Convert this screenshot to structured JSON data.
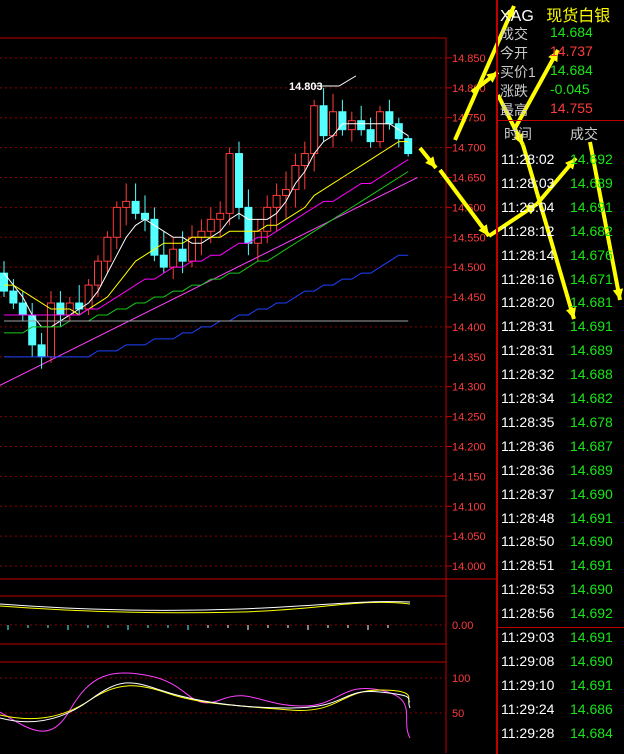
{
  "quote": {
    "symbol": "XAG",
    "name": "现货白银",
    "rows": [
      {
        "label": "成交",
        "value": "14.684",
        "color": "#19e619"
      },
      {
        "label": "今开",
        "value": "14.737",
        "color": "#ff3b3b"
      },
      {
        "label": "买价1",
        "value": "14.684",
        "color": "#19e619"
      },
      {
        "label": "涨跌",
        "value": "-0.045",
        "color": "#19e619"
      },
      {
        "label": "最高",
        "value": "14.755",
        "color": "#ff3b3b"
      }
    ]
  },
  "ticks": {
    "header_time": "时间",
    "header_price": "成交",
    "rows": [
      {
        "time": "11:28:02",
        "price": "14.692"
      },
      {
        "time": "11:28:03",
        "price": "14.689"
      },
      {
        "time": "11:28:04",
        "price": "14.691"
      },
      {
        "time": "11:28:12",
        "price": "14.682"
      },
      {
        "time": "11:28:14",
        "price": "14.676"
      },
      {
        "time": "11:28:16",
        "price": "14.671"
      },
      {
        "time": "11:28:20",
        "price": "14.681"
      },
      {
        "time": "11:28:31",
        "price": "14.691"
      },
      {
        "time": "11:28:31",
        "price": "14.689"
      },
      {
        "time": "11:28:32",
        "price": "14.688"
      },
      {
        "time": "11:28:34",
        "price": "14.682"
      },
      {
        "time": "11:28:35",
        "price": "14.678"
      },
      {
        "time": "11:28:36",
        "price": "14.687"
      },
      {
        "time": "11:28:36",
        "price": "14.689"
      },
      {
        "time": "11:28:37",
        "price": "14.690"
      },
      {
        "time": "11:28:48",
        "price": "14.691"
      },
      {
        "time": "11:28:50",
        "price": "14.690"
      },
      {
        "time": "11:28:51",
        "price": "14.691"
      },
      {
        "time": "11:28:53",
        "price": "14.690"
      },
      {
        "time": "11:28:56",
        "price": "14.692"
      },
      {
        "time": "11:29:03",
        "price": "14.691"
      },
      {
        "time": "11:29:08",
        "price": "14.690"
      },
      {
        "time": "11:29:10",
        "price": "14.691"
      },
      {
        "time": "11:29:24",
        "price": "14.686"
      },
      {
        "time": "11:29:28",
        "price": "14.684"
      }
    ]
  },
  "colors": {
    "up": "#ff3b3b",
    "down": "#54ffff",
    "grid": "#8b0000",
    "axis": "#ff3b3b",
    "tick_price": "#19e619"
  },
  "chart_data": {
    "type": "candlestick",
    "price_axis": {
      "ticks": [
        14.85,
        14.8,
        14.75,
        14.7,
        14.65,
        14.6,
        14.55,
        14.5,
        14.45,
        14.4,
        14.35,
        14.3,
        14.25,
        14.2,
        14.15,
        14.1,
        14.05,
        14.0
      ],
      "tick_labels": [
        "14.850",
        "14.800",
        "14.750",
        "14.700",
        "14.650",
        "14.600",
        "14.550",
        "14.500",
        "14.450",
        "14.400",
        "14.350",
        "14.300",
        "14.250",
        "14.200",
        "14.150",
        "14.100",
        "14.050",
        "14.000"
      ],
      "ylim": [
        13.98,
        14.88
      ]
    },
    "high_label": "14.803",
    "candles": [
      {
        "o": 14.49,
        "h": 14.51,
        "l": 14.45,
        "c": 14.46
      },
      {
        "o": 14.46,
        "h": 14.48,
        "l": 14.43,
        "c": 14.44
      },
      {
        "o": 14.44,
        "h": 14.46,
        "l": 14.41,
        "c": 14.42
      },
      {
        "o": 14.42,
        "h": 14.44,
        "l": 14.35,
        "c": 14.37
      },
      {
        "o": 14.37,
        "h": 14.39,
        "l": 14.33,
        "c": 14.35
      },
      {
        "o": 14.35,
        "h": 14.46,
        "l": 14.34,
        "c": 14.44
      },
      {
        "o": 14.44,
        "h": 14.46,
        "l": 14.4,
        "c": 14.42
      },
      {
        "o": 14.42,
        "h": 14.45,
        "l": 14.41,
        "c": 14.44
      },
      {
        "o": 14.44,
        "h": 14.47,
        "l": 14.42,
        "c": 14.43
      },
      {
        "o": 14.43,
        "h": 14.48,
        "l": 14.42,
        "c": 14.47
      },
      {
        "o": 14.47,
        "h": 14.52,
        "l": 14.45,
        "c": 14.51
      },
      {
        "o": 14.51,
        "h": 14.56,
        "l": 14.49,
        "c": 14.55
      },
      {
        "o": 14.55,
        "h": 14.61,
        "l": 14.53,
        "c": 14.6
      },
      {
        "o": 14.6,
        "h": 14.64,
        "l": 14.57,
        "c": 14.61
      },
      {
        "o": 14.61,
        "h": 14.64,
        "l": 14.58,
        "c": 14.59
      },
      {
        "o": 14.59,
        "h": 14.62,
        "l": 14.56,
        "c": 14.58
      },
      {
        "o": 14.58,
        "h": 14.6,
        "l": 14.51,
        "c": 14.52
      },
      {
        "o": 14.52,
        "h": 14.56,
        "l": 14.49,
        "c": 14.5
      },
      {
        "o": 14.5,
        "h": 14.55,
        "l": 14.48,
        "c": 14.53
      },
      {
        "o": 14.53,
        "h": 14.56,
        "l": 14.49,
        "c": 14.51
      },
      {
        "o": 14.51,
        "h": 14.57,
        "l": 14.5,
        "c": 14.55
      },
      {
        "o": 14.55,
        "h": 14.58,
        "l": 14.52,
        "c": 14.56
      },
      {
        "o": 14.56,
        "h": 14.6,
        "l": 14.54,
        "c": 14.58
      },
      {
        "o": 14.58,
        "h": 14.61,
        "l": 14.55,
        "c": 14.59
      },
      {
        "o": 14.59,
        "h": 14.7,
        "l": 14.57,
        "c": 14.69
      },
      {
        "o": 14.69,
        "h": 14.71,
        "l": 14.58,
        "c": 14.6
      },
      {
        "o": 14.6,
        "h": 14.63,
        "l": 14.52,
        "c": 14.54
      },
      {
        "o": 14.54,
        "h": 14.58,
        "l": 14.51,
        "c": 14.56
      },
      {
        "o": 14.56,
        "h": 14.62,
        "l": 14.54,
        "c": 14.6
      },
      {
        "o": 14.6,
        "h": 14.64,
        "l": 14.56,
        "c": 14.62
      },
      {
        "o": 14.62,
        "h": 14.66,
        "l": 14.58,
        "c": 14.63
      },
      {
        "o": 14.63,
        "h": 14.69,
        "l": 14.6,
        "c": 14.67
      },
      {
        "o": 14.67,
        "h": 14.71,
        "l": 14.63,
        "c": 14.69
      },
      {
        "o": 14.69,
        "h": 14.78,
        "l": 14.66,
        "c": 14.77
      },
      {
        "o": 14.77,
        "h": 14.8,
        "l": 14.71,
        "c": 14.72
      },
      {
        "o": 14.72,
        "h": 14.79,
        "l": 14.7,
        "c": 14.76
      },
      {
        "o": 14.76,
        "h": 14.78,
        "l": 14.72,
        "c": 14.73
      },
      {
        "o": 14.73,
        "h": 14.76,
        "l": 14.71,
        "c": 14.745
      },
      {
        "o": 14.745,
        "h": 14.77,
        "l": 14.72,
        "c": 14.73
      },
      {
        "o": 14.73,
        "h": 14.75,
        "l": 14.7,
        "c": 14.71
      },
      {
        "o": 14.71,
        "h": 14.77,
        "l": 14.7,
        "c": 14.76
      },
      {
        "o": 14.76,
        "h": 14.78,
        "l": 14.73,
        "c": 14.74
      },
      {
        "o": 14.74,
        "h": 14.75,
        "l": 14.7,
        "c": 14.715
      },
      {
        "o": 14.715,
        "h": 14.72,
        "l": 14.685,
        "c": 14.69
      }
    ],
    "ma_lines": [
      {
        "color": "#ffffff",
        "values": [
          14.49,
          14.47,
          14.45,
          14.42,
          14.4,
          14.4,
          14.41,
          14.42,
          14.43,
          14.44,
          14.46,
          14.49,
          14.52,
          14.55,
          14.57,
          14.58,
          14.57,
          14.56,
          14.55,
          14.55,
          14.54,
          14.54,
          14.55,
          14.56,
          14.58,
          14.59,
          14.58,
          14.58,
          14.58,
          14.59,
          14.61,
          14.64,
          14.66,
          14.69,
          14.71,
          14.72,
          14.74,
          14.74,
          14.74,
          14.74,
          14.74,
          14.74,
          14.73,
          14.72
        ]
      },
      {
        "color": "#ffff00",
        "values": [
          14.47,
          14.47,
          14.46,
          14.45,
          14.44,
          14.43,
          14.43,
          14.43,
          14.42,
          14.43,
          14.44,
          14.45,
          14.47,
          14.49,
          14.51,
          14.52,
          14.53,
          14.54,
          14.54,
          14.54,
          14.55,
          14.55,
          14.55,
          14.55,
          14.56,
          14.56,
          14.56,
          14.56,
          14.57,
          14.57,
          14.58,
          14.59,
          14.6,
          14.62,
          14.63,
          14.64,
          14.65,
          14.66,
          14.67,
          14.68,
          14.69,
          14.7,
          14.71,
          14.71
        ]
      },
      {
        "color": "#ff00ff",
        "values": [
          14.42,
          14.42,
          14.42,
          14.42,
          14.42,
          14.42,
          14.42,
          14.42,
          14.42,
          14.43,
          14.43,
          14.44,
          14.45,
          14.46,
          14.47,
          14.48,
          14.48,
          14.49,
          14.5,
          14.5,
          14.51,
          14.51,
          14.52,
          14.52,
          14.53,
          14.54,
          14.54,
          14.55,
          14.55,
          14.56,
          14.57,
          14.58,
          14.59,
          14.6,
          14.61,
          14.61,
          14.62,
          14.63,
          14.64,
          14.64,
          14.65,
          14.66,
          14.67,
          14.68
        ]
      },
      {
        "color": "#19c819",
        "values": [
          14.39,
          14.39,
          14.39,
          14.4,
          14.4,
          14.4,
          14.4,
          14.41,
          14.41,
          14.41,
          14.42,
          14.42,
          14.43,
          14.43,
          14.44,
          14.44,
          14.45,
          14.45,
          14.46,
          14.46,
          14.47,
          14.47,
          14.48,
          14.48,
          14.49,
          14.49,
          14.5,
          14.51,
          14.51,
          14.52,
          14.53,
          14.54,
          14.55,
          14.56,
          14.57,
          14.58,
          14.59,
          14.6,
          14.61,
          14.62,
          14.63,
          14.64,
          14.65,
          14.66
        ]
      },
      {
        "color": "#2040ff",
        "values": [
          14.35,
          14.35,
          14.35,
          14.35,
          14.35,
          14.35,
          14.35,
          14.35,
          14.35,
          14.35,
          14.36,
          14.36,
          14.36,
          14.37,
          14.37,
          14.37,
          14.38,
          14.38,
          14.38,
          14.39,
          14.39,
          14.4,
          14.4,
          14.41,
          14.41,
          14.42,
          14.42,
          14.43,
          14.43,
          14.44,
          14.44,
          14.45,
          14.46,
          14.46,
          14.47,
          14.47,
          14.48,
          14.48,
          14.49,
          14.49,
          14.5,
          14.51,
          14.52,
          14.52
        ]
      },
      {
        "color": "#a0a0a0",
        "values": [
          14.41,
          14.41,
          14.41,
          14.41,
          14.41,
          14.41,
          14.41,
          14.41,
          14.41,
          14.41,
          14.41,
          14.41,
          14.41,
          14.41,
          14.41,
          14.41,
          14.41,
          14.41,
          14.41,
          14.41,
          14.41,
          14.41,
          14.41,
          14.41,
          14.41,
          14.41,
          14.41,
          14.41,
          14.41,
          14.41,
          14.41,
          14.41,
          14.41,
          14.41,
          14.41,
          14.41,
          14.41,
          14.41,
          14.41,
          14.41,
          14.41,
          14.41,
          14.41,
          14.41
        ]
      }
    ],
    "trendline": {
      "color": "#ff40ff",
      "from": {
        "x": -2,
        "y": 14.29
      },
      "to": {
        "x": 44,
        "y": 14.65
      }
    },
    "macd_panel": {
      "tick_label": "0.00"
    },
    "kdj_panel": {
      "tick_labels": [
        "100",
        "50"
      ]
    }
  }
}
